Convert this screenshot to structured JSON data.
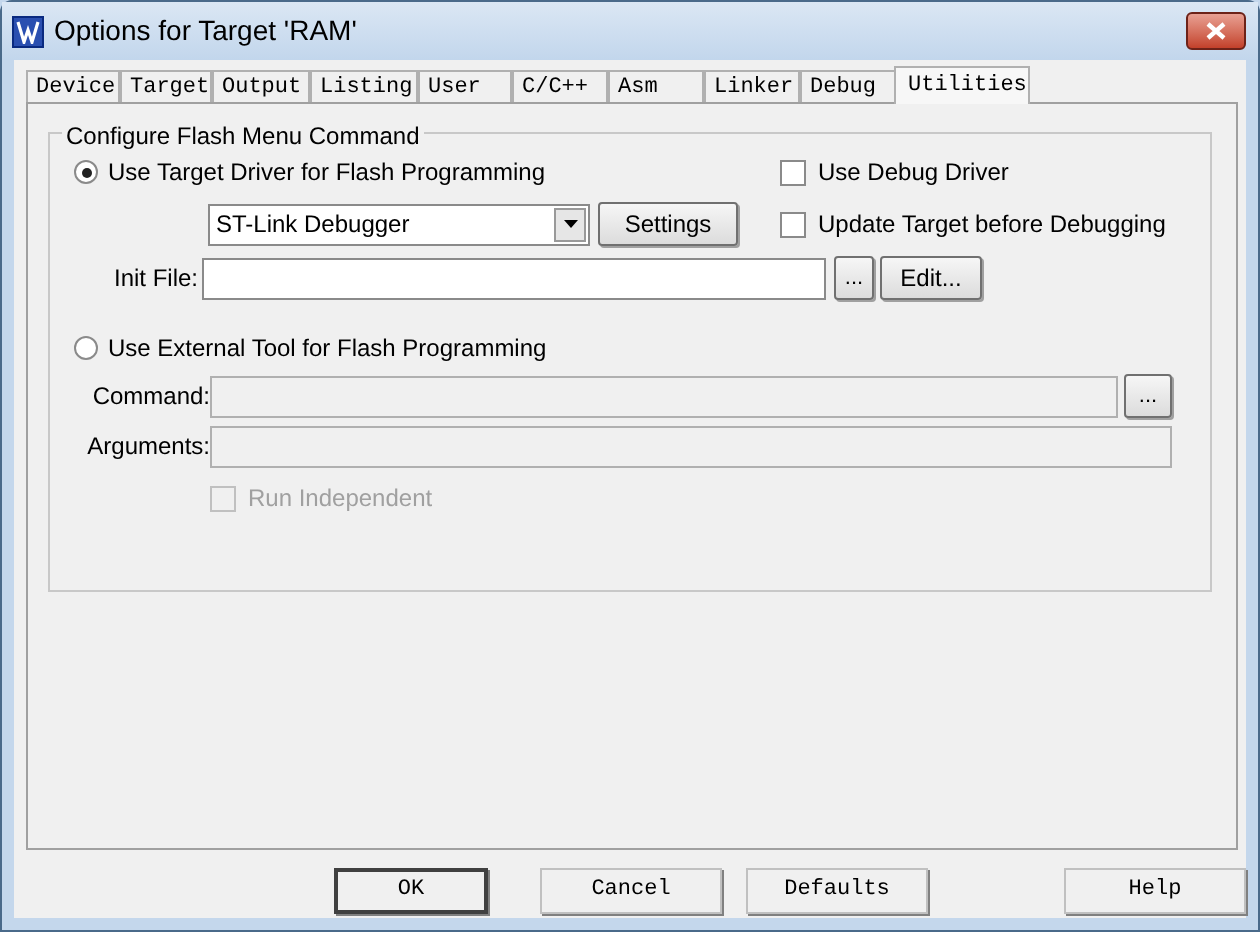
{
  "window": {
    "title": "Options for Target 'RAM'"
  },
  "tabs": [
    {
      "label": "Device",
      "selected": false
    },
    {
      "label": "Target",
      "selected": false
    },
    {
      "label": "Output",
      "selected": false
    },
    {
      "label": "Listing",
      "selected": false
    },
    {
      "label": "User",
      "selected": false
    },
    {
      "label": "C/C++",
      "selected": false
    },
    {
      "label": "Asm",
      "selected": false
    },
    {
      "label": "Linker",
      "selected": false
    },
    {
      "label": "Debug",
      "selected": false
    },
    {
      "label": "Utilities",
      "selected": true
    }
  ],
  "group": {
    "title": "Configure Flash Menu Command",
    "target_driver": {
      "label": "Use Target Driver for Flash Programming",
      "selected": true
    },
    "use_debug_driver": {
      "label": "Use Debug Driver",
      "checked": false
    },
    "driver": {
      "value": "ST-Link Debugger"
    },
    "settings_button": "Settings",
    "update_target": {
      "label": "Update Target before Debugging",
      "checked": false
    },
    "init_file": {
      "label": "Init File:",
      "browse": "...",
      "edit": "Edit..."
    },
    "external_tool": {
      "label": "Use External Tool for Flash Programming",
      "selected": false
    },
    "command": {
      "label": "Command:",
      "browse": "...",
      "disabled": true
    },
    "arguments": {
      "label": "Arguments:",
      "disabled": true
    },
    "run_independent": {
      "label": "Run Independent",
      "checked": false,
      "disabled": true
    }
  },
  "buttons": [
    {
      "label": "OK",
      "default": true
    },
    {
      "label": "Cancel",
      "default": false
    },
    {
      "label": "Defaults",
      "default": false
    },
    {
      "label": "Help",
      "default": false
    }
  ]
}
